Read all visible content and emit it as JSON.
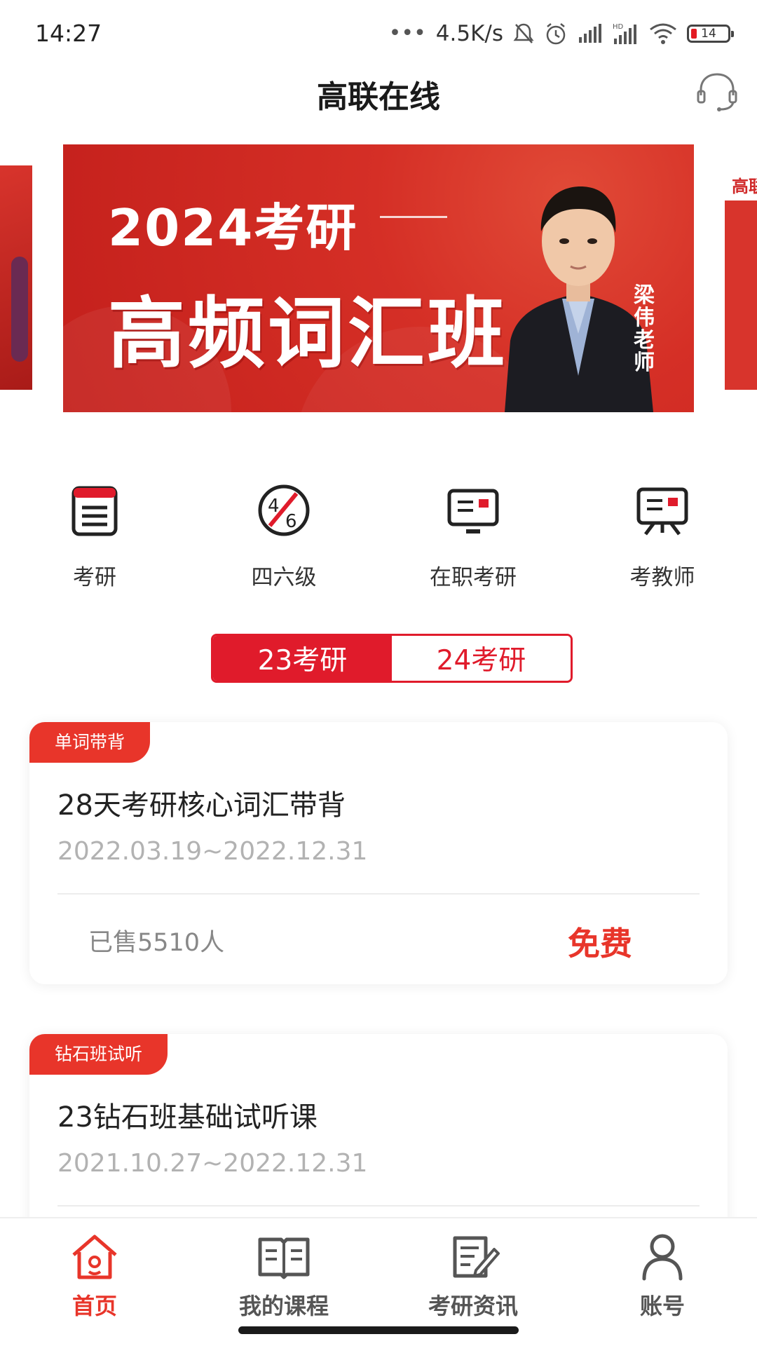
{
  "status_bar": {
    "time": "14:27",
    "net_speed": "4.5K/s",
    "battery": "14",
    "icons": [
      "more-dots-icon",
      "mute-bell-icon",
      "alarm-icon",
      "signal-icon",
      "hd-signal-icon",
      "wifi-icon",
      "battery-icon"
    ]
  },
  "header": {
    "title": "高联在线",
    "support_icon": "headset-icon"
  },
  "banner": {
    "year_text": "2024考研",
    "course_text": "高频词汇班",
    "teacher": "梁伟老师",
    "right_peek_text": "高联"
  },
  "categories": [
    {
      "label": "考研",
      "icon": "document-icon"
    },
    {
      "label": "四六级",
      "icon": "cet-4-6-icon"
    },
    {
      "label": "在职考研",
      "icon": "monitor-icon"
    },
    {
      "label": "考教师",
      "icon": "blackboard-icon"
    }
  ],
  "year_tabs": [
    {
      "label": "23考研",
      "active": true
    },
    {
      "label": "24考研",
      "active": false
    }
  ],
  "courses": [
    {
      "badge": "单词带背",
      "title": "28天考研核心词汇带背",
      "date": "2022.03.19~2022.12.31",
      "sold": "已售5510人",
      "price": "免费"
    },
    {
      "badge": "钻石班试听",
      "title": "23钻石班基础试听课",
      "date": "2021.10.27~2022.12.31"
    }
  ],
  "bottom_nav": [
    {
      "label": "首页",
      "icon": "home-icon",
      "active": true
    },
    {
      "label": "我的课程",
      "icon": "book-icon",
      "active": false
    },
    {
      "label": "考研资讯",
      "icon": "news-edit-icon",
      "active": false
    },
    {
      "label": "账号",
      "icon": "user-icon",
      "active": false
    }
  ],
  "colors": {
    "accent": "#e01b2b",
    "badge": "#e8352a",
    "price": "#e8352a"
  }
}
